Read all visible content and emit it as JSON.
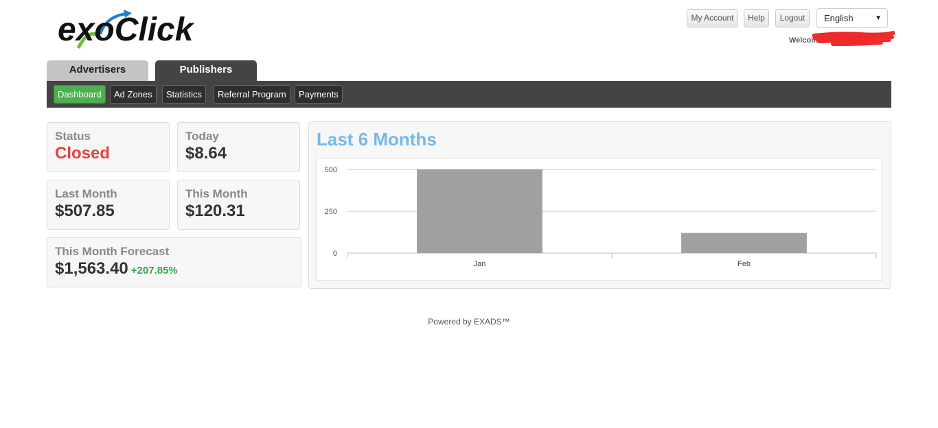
{
  "header": {
    "logo_text": "exoClick",
    "my_account_label": "My Account",
    "help_label": "Help",
    "logout_label": "Logout",
    "language_selected": "English",
    "welcome_text": "Welcome,"
  },
  "main_tabs": [
    {
      "label": "Advertisers",
      "active": false
    },
    {
      "label": "Publishers",
      "active": true
    }
  ],
  "subnav": [
    {
      "label": "Dashboard",
      "active": true
    },
    {
      "label": "Ad Zones"
    },
    {
      "label": "Statistics"
    },
    {
      "label": "Referral Program"
    },
    {
      "label": "Payments"
    }
  ],
  "stats": {
    "status": {
      "label": "Status",
      "value": "Closed"
    },
    "today": {
      "label": "Today",
      "value": "$8.64"
    },
    "last_month": {
      "label": "Last Month",
      "value": "$507.85"
    },
    "this_month": {
      "label": "This Month",
      "value": "$120.31"
    },
    "forecast": {
      "label": "This Month Forecast",
      "value": "$1,563.40",
      "change": "+207.85%"
    }
  },
  "chart": {
    "title": "Last 6 Months"
  },
  "chart_data": {
    "type": "bar",
    "categories": [
      "Jan",
      "Feb"
    ],
    "values": [
      507.85,
      120.31
    ],
    "yticks": [
      0,
      250,
      500
    ],
    "ylim": [
      0,
      500
    ],
    "bar_color": "#a0a0a0",
    "grid": true
  },
  "footer": {
    "text": "Powered by EXADS™"
  },
  "colors": {
    "accent_green": "#4caf50",
    "status_red": "#e8423a",
    "chart_title_blue": "#73b9ea",
    "nav_dark": "#444444"
  }
}
